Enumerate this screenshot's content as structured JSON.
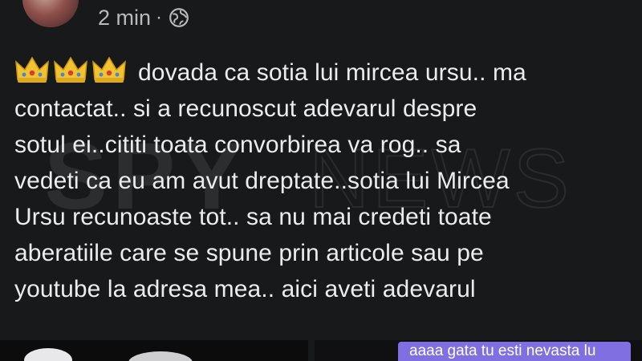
{
  "post": {
    "timestamp": "2 min",
    "separator": "·",
    "visibility_icon": "globe-icon",
    "emoji": [
      "crown",
      "crown",
      "crown"
    ],
    "lines": [
      "dovada ca sotia lui mircea ursu.. ma",
      "contactat.. si a recunoscut adevarul despre",
      "sotul ei..cititi toata convorbirea va rog.. sa",
      "vedeti ca eu am avut dreptate..sotia lui Mircea",
      "Ursu recunoaste tot.. sa nu mai credeti toate",
      "aberatiile care se spune prin articole sau pe",
      "youtube la adresa mea.. aici aveti adevarul"
    ]
  },
  "watermark": {
    "brand": "SPY",
    "suffix": "NEWS"
  },
  "attachments": {
    "chat_preview_text": "aaaa gata tu esti nevasta lu"
  },
  "colors": {
    "background": "#18191b",
    "text": "#ececee",
    "meta": "#b8babd",
    "chat_bubble": "#7f6fe0"
  }
}
